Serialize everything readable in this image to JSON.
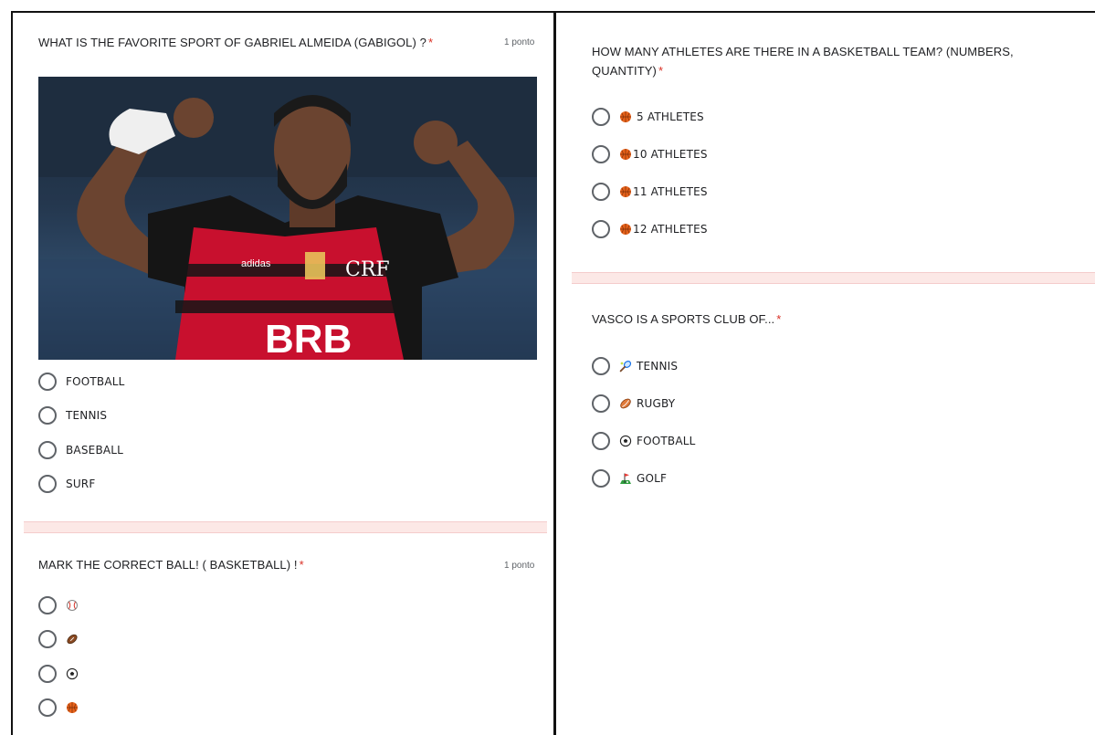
{
  "left": {
    "q1": {
      "title": "WHAT IS THE FAVORITE SPORT OF GABRIEL ALMEIDA (GABIGOL) ?",
      "required": "*",
      "points": "1 ponto",
      "image": {
        "jersey_text": "BRB",
        "brand_text": "adidas",
        "crest_text": "CRF"
      },
      "options": [
        "FOOTBALL",
        "TENNIS",
        "BASEBALL",
        "SURF"
      ]
    },
    "q2": {
      "title": "MARK THE CORRECT BALL! ( BASKETBALL) !",
      "required": "*",
      "points": "1 ponto",
      "options": [
        {
          "icon": "baseball-icon"
        },
        {
          "icon": "american-football-icon"
        },
        {
          "icon": "soccer-ball-icon"
        },
        {
          "icon": "basketball-icon"
        }
      ]
    }
  },
  "right": {
    "q3": {
      "title_line1": "HOW MANY ATHLETES ARE THERE IN A BASKETBALL TEAM? (NUMBERS,",
      "title_line2": "QUANTITY)",
      "required": "*",
      "options": [
        {
          "icon": "basketball-icon",
          "label": "5 ATHLETES"
        },
        {
          "icon": "basketball-icon",
          "label": "10 ATHLETES"
        },
        {
          "icon": "basketball-icon",
          "label": "11 ATHLETES"
        },
        {
          "icon": "basketball-icon",
          "label": "12 ATHLETES"
        }
      ]
    },
    "q4": {
      "title": "VASCO IS A SPORTS CLUB OF...",
      "required": "*",
      "options": [
        {
          "icon": "tennis-racket-icon",
          "label": "TENNIS"
        },
        {
          "icon": "rugby-ball-icon",
          "label": "RUGBY"
        },
        {
          "icon": "soccer-ball-icon",
          "label": "FOOTBALL"
        },
        {
          "icon": "golf-flag-icon",
          "label": "GOLF"
        }
      ]
    }
  },
  "colors": {
    "required": "#d93025",
    "separator": "#fce8e6",
    "radio_border": "#5f6368",
    "jersey_red": "#c8102e",
    "jersey_black": "#151515"
  }
}
